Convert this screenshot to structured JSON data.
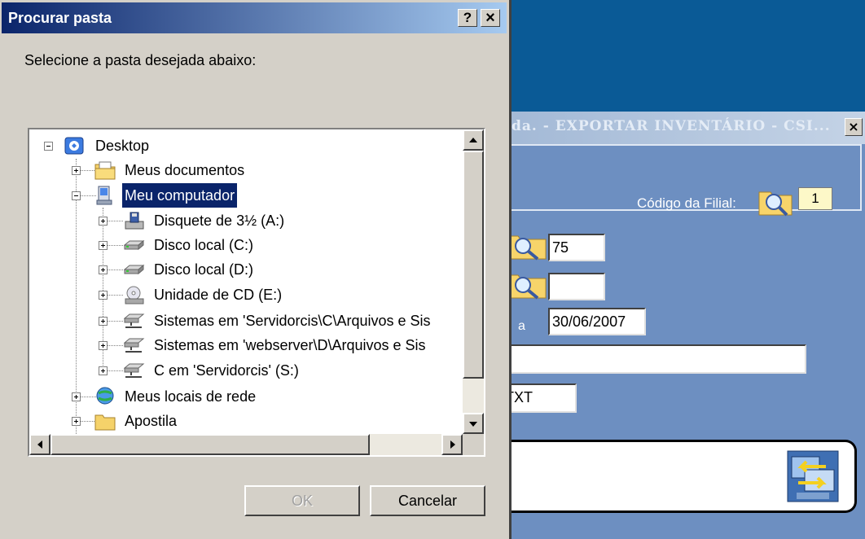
{
  "dialog": {
    "title": "Procurar pasta",
    "help_button": "?",
    "close_button": "×",
    "instruction": "Selecione a pasta desejada abaixo:",
    "ok_label": "OK",
    "ok_enabled": false,
    "cancel_label": "Cancelar"
  },
  "tree": {
    "items": [
      {
        "label": "Desktop",
        "icon": "desktop-icon",
        "level": 0,
        "expanded": true,
        "selected": false
      },
      {
        "label": "Meus documentos",
        "icon": "documents-folder-icon",
        "level": 1,
        "expanded": false,
        "selected": false
      },
      {
        "label": "Meu computador",
        "icon": "computer-icon",
        "level": 1,
        "expanded": true,
        "selected": true
      },
      {
        "label": "Disquete de 3½ (A:)",
        "icon": "floppy-drive-icon",
        "level": 2,
        "expanded": false,
        "selected": false
      },
      {
        "label": "Disco local (C:)",
        "icon": "hard-drive-icon",
        "level": 2,
        "expanded": false,
        "selected": false
      },
      {
        "label": "Disco local (D:)",
        "icon": "hard-drive-icon",
        "level": 2,
        "expanded": false,
        "selected": false
      },
      {
        "label": "Unidade de CD (E:)",
        "icon": "cd-drive-icon",
        "level": 2,
        "expanded": false,
        "selected": false
      },
      {
        "label": "Sistemas em 'Servidorcis\\C\\Arquivos e Sis",
        "icon": "network-drive-icon",
        "level": 2,
        "expanded": false,
        "selected": false
      },
      {
        "label": "Sistemas em 'webserver\\D\\Arquivos e Sis",
        "icon": "network-drive-icon",
        "level": 2,
        "expanded": false,
        "selected": false
      },
      {
        "label": "C em 'Servidorcis' (S:)",
        "icon": "network-drive-icon",
        "level": 2,
        "expanded": false,
        "selected": false
      },
      {
        "label": "Meus locais de rede",
        "icon": "network-places-icon",
        "level": 1,
        "expanded": false,
        "selected": false
      },
      {
        "label": "Apostila",
        "icon": "folder-icon",
        "level": 1,
        "expanded": false,
        "selected": false
      }
    ]
  },
  "background_app": {
    "title": "da. - EXPORTAR INVENTÁRIO - CSI...",
    "close_button": "×",
    "branch_label": "Código da Filial:",
    "branch_value": "1",
    "field1_value": "75",
    "field2_value": "",
    "range_label": "a",
    "date_value": "30/06/2007",
    "path_value": "",
    "ext_value": "TXT"
  },
  "colors": {
    "desktop": "#0a5a96",
    "dialog_face": "#d4d0c8",
    "title_gradient_start": "#0a246a",
    "title_gradient_end": "#a6caf0",
    "selection": "#0a246a",
    "app_panel": "#6d8fc1",
    "highlight_field": "#fdf8c8"
  }
}
